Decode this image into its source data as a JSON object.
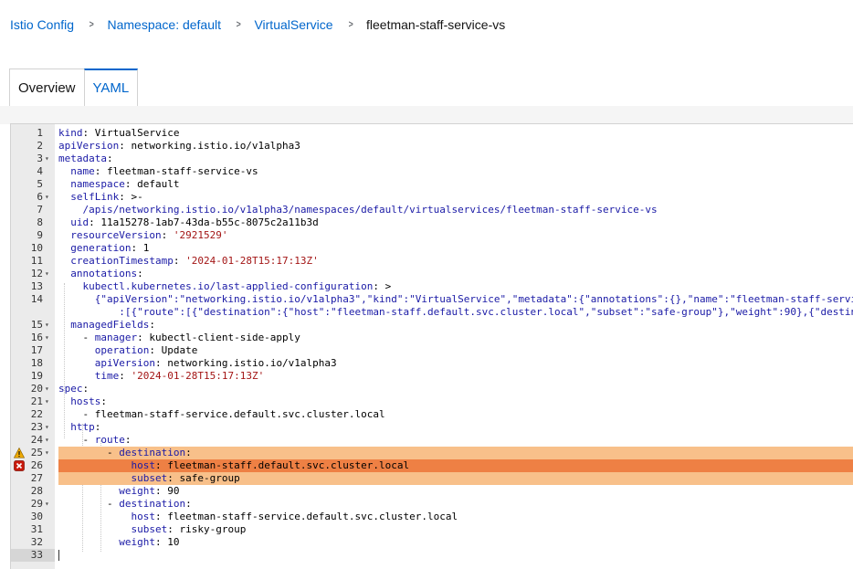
{
  "breadcrumb": {
    "items": [
      "Istio Config",
      "Namespace: default",
      "VirtualService"
    ],
    "current": "fleetman-staff-service-vs"
  },
  "tabs": [
    "Overview",
    "YAML"
  ],
  "editor": {
    "lines": [
      {
        "n": "1",
        "f": "",
        "t": "kind: VirtualService"
      },
      {
        "n": "2",
        "f": "",
        "t": "apiVersion: networking.istio.io/v1alpha3"
      },
      {
        "n": "3",
        "f": "▾",
        "t": "metadata:"
      },
      {
        "n": "4",
        "f": "",
        "t": "  name: fleetman-staff-service-vs"
      },
      {
        "n": "5",
        "f": "",
        "t": "  namespace: default"
      },
      {
        "n": "6",
        "f": "▾",
        "t": "  selfLink: >-"
      },
      {
        "n": "7",
        "f": "",
        "t": "    /apis/networking.istio.io/v1alpha3/namespaces/default/virtualservices/fleetman-staff-service-vs"
      },
      {
        "n": "8",
        "f": "",
        "t": "  uid: 11a15278-1ab7-43da-b55c-8075c2a11b3d"
      },
      {
        "n": "9",
        "f": "",
        "t": "  resourceVersion: '2921529'"
      },
      {
        "n": "10",
        "f": "",
        "t": "  generation: 1"
      },
      {
        "n": "11",
        "f": "",
        "t": "  creationTimestamp: '2024-01-28T15:17:13Z'"
      },
      {
        "n": "12",
        "f": "▾",
        "t": "  annotations:"
      },
      {
        "n": "13",
        "f": "",
        "t": "    kubectl.kubernetes.io/last-applied-configuration: >"
      },
      {
        "n": "14",
        "f": "",
        "t": "      {\"apiVersion\":\"networking.istio.io/v1alpha3\",\"kind\":\"VirtualService\",\"metadata\":{\"annotations\":{},\"name\":\"fleetman-staff-servi"
      },
      {
        "n": "",
        "f": "",
        "t": "          :[{\"route\":[{\"destination\":{\"host\":\"fleetman-staff.default.svc.cluster.local\",\"subset\":\"safe-group\"},\"weight\":90},{\"destin"
      },
      {
        "n": "15",
        "f": "▾",
        "t": "  managedFields:"
      },
      {
        "n": "16",
        "f": "▾",
        "t": "    - manager: kubectl-client-side-apply"
      },
      {
        "n": "17",
        "f": "",
        "t": "      operation: Update"
      },
      {
        "n": "18",
        "f": "",
        "t": "      apiVersion: networking.istio.io/v1alpha3"
      },
      {
        "n": "19",
        "f": "",
        "t": "      time: '2024-01-28T15:17:13Z'"
      },
      {
        "n": "20",
        "f": "▾",
        "t": "spec:"
      },
      {
        "n": "21",
        "f": "▾",
        "t": "  hosts:"
      },
      {
        "n": "22",
        "f": "",
        "t": "    - fleetman-staff-service.default.svc.cluster.local"
      },
      {
        "n": "23",
        "f": "▾",
        "t": "  http:"
      },
      {
        "n": "24",
        "f": "▾",
        "t": "    - route:"
      },
      {
        "n": "25",
        "f": "▾",
        "t": "        - destination:",
        "mark": "warn"
      },
      {
        "n": "26",
        "f": "",
        "t": "            host: fleetman-staff.default.svc.cluster.local",
        "mark": "err"
      },
      {
        "n": "27",
        "f": "",
        "t": "            subset: safe-group",
        "mark": "warnbg"
      },
      {
        "n": "28",
        "f": "",
        "t": "          weight: 90"
      },
      {
        "n": "29",
        "f": "▾",
        "t": "        - destination:"
      },
      {
        "n": "30",
        "f": "",
        "t": "            host: fleetman-staff-service.default.svc.cluster.local"
      },
      {
        "n": "31",
        "f": "",
        "t": "            subset: risky-group"
      },
      {
        "n": "32",
        "f": "",
        "t": "          weight: 10"
      },
      {
        "n": "33",
        "f": "",
        "t": "",
        "active": true
      }
    ]
  },
  "colors": {
    "link": "#0066cc",
    "warn_bg": "#f8c08a",
    "error_bg": "#ee8044"
  },
  "icons": {
    "warning": "warning-icon",
    "error": "error-icon"
  }
}
